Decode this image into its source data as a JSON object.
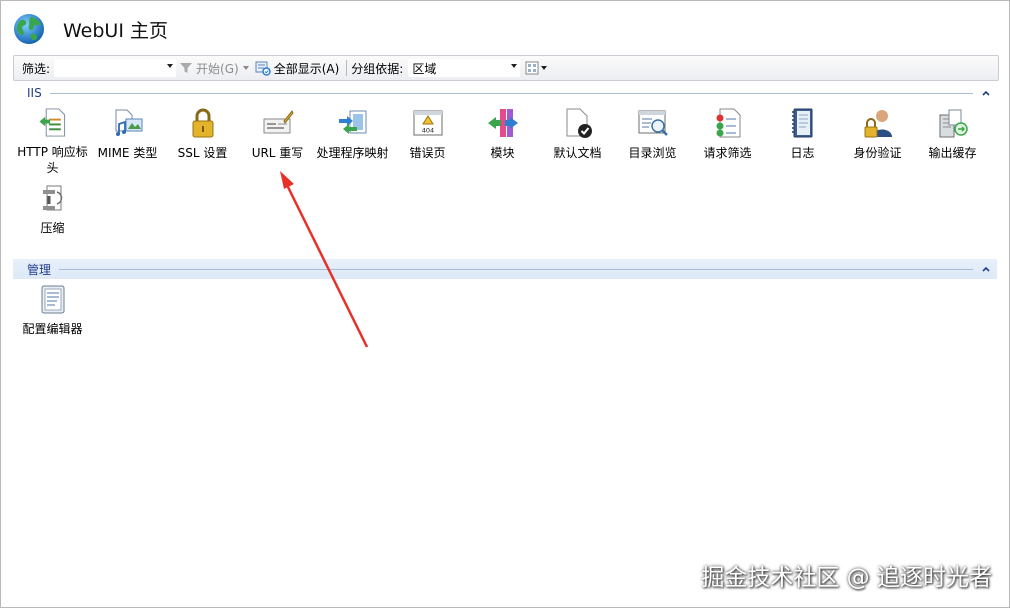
{
  "window": {
    "title": "WebUI 主页"
  },
  "toolbar": {
    "filter_label": "筛选:",
    "filter_value": "",
    "start_label": "开始(G)",
    "show_all_label": "全部显示(A)",
    "group_by_label": "分组依据:",
    "group_by_value": "区域"
  },
  "sections": {
    "iis": {
      "title": "IIS",
      "features": [
        {
          "label": "HTTP 响应标头",
          "icon": "http-response-headers-icon"
        },
        {
          "label": "MIME 类型",
          "icon": "mime-types-icon"
        },
        {
          "label": "SSL 设置",
          "icon": "ssl-lock-icon"
        },
        {
          "label": "URL 重写",
          "icon": "url-rewrite-icon"
        },
        {
          "label": "处理程序映射",
          "icon": "handler-mappings-icon"
        },
        {
          "label": "错误页",
          "icon": "error-pages-icon"
        },
        {
          "label": "模块",
          "icon": "modules-icon"
        },
        {
          "label": "默认文档",
          "icon": "default-document-icon"
        },
        {
          "label": "目录浏览",
          "icon": "directory-browsing-icon"
        },
        {
          "label": "请求筛选",
          "icon": "request-filtering-icon"
        },
        {
          "label": "日志",
          "icon": "logging-icon"
        },
        {
          "label": "身份验证",
          "icon": "authentication-icon"
        },
        {
          "label": "输出缓存",
          "icon": "output-caching-icon"
        },
        {
          "label": "压缩",
          "icon": "compression-icon"
        }
      ]
    },
    "management": {
      "title": "管理",
      "features": [
        {
          "label": "配置编辑器",
          "icon": "configuration-editor-icon"
        }
      ]
    }
  },
  "annotation": {
    "arrow_color": "#e8302a"
  },
  "watermark": "掘金技术社区 @ 追逐时光者"
}
